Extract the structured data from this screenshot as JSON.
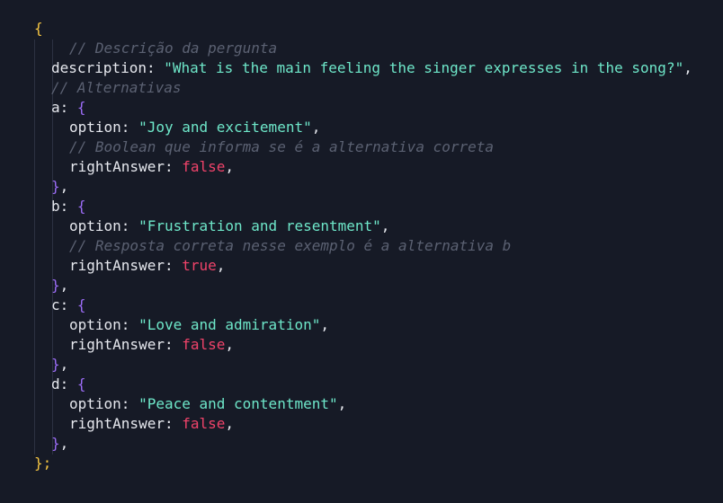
{
  "code": {
    "open_brace": "{",
    "close_brace": "};",
    "comment_description": "// Descrição da pergunta",
    "description_key": "description",
    "description_value": "\"What is the main feeling the singer expresses in the song?\"",
    "comment_alternatives": "// Alternativas",
    "comment_boolean": "// Boolean que informa se é a alternativa correta",
    "comment_correct": "// Resposta correta nesse exemplo é a alternativa b",
    "option_key": "option",
    "right_answer_key": "rightAnswer",
    "colon": ": ",
    "comma": ",",
    "inner_open": "{",
    "inner_close": "}",
    "alternatives": [
      {
        "key": "a",
        "option": "\"Joy and excitement\"",
        "right_answer": "false"
      },
      {
        "key": "b",
        "option": "\"Frustration and resentment\"",
        "right_answer": "true"
      },
      {
        "key": "c",
        "option": "\"Love and admiration\"",
        "right_answer": "false"
      },
      {
        "key": "d",
        "option": "\"Peace and contentment\"",
        "right_answer": "false"
      }
    ]
  },
  "colors": {
    "background": "#161a26",
    "outer_brace": "#f5c542",
    "inner_brace": "#9b6cf5",
    "string": "#6ee7c9",
    "comment": "#5b6172",
    "boolean": "#f0436a",
    "text": "#e6e8ee"
  }
}
